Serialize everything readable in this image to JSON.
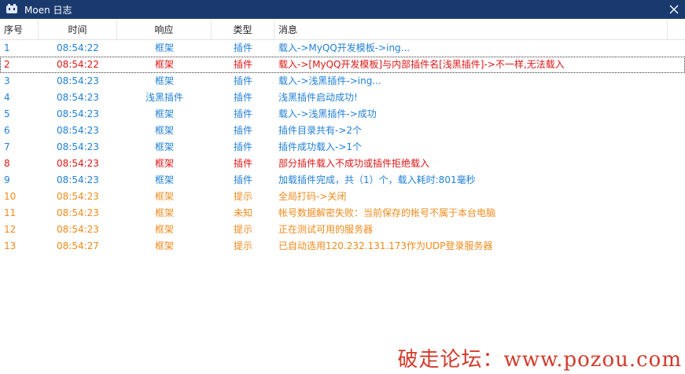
{
  "window": {
    "title": "Moen 日志",
    "app_icon": "moen-app-icon",
    "close_icon": "close-icon"
  },
  "colors": {
    "titlebar": "#1a3a6e",
    "blue": "#1f7fd6",
    "red": "#e01515",
    "orange": "#ef8a1a",
    "watermark": "#d23a2a"
  },
  "columns": {
    "idx": "序号",
    "time": "时间",
    "resp": "响应",
    "type": "类型",
    "msg": "消息"
  },
  "rows": [
    {
      "idx": "1",
      "time": "08:54:22",
      "resp": "框架",
      "type": "插件",
      "msg": "载入->MyQQ开发模板->ing...",
      "color": "#1f7fd6"
    },
    {
      "idx": "2",
      "time": "08:54:22",
      "resp": "框架",
      "type": "插件",
      "msg": "载入->[MyQQ开发模板]与内部插件名[浅黑插件]->不一样,无法载入",
      "color": "#e01515",
      "selected": true
    },
    {
      "idx": "3",
      "time": "08:54:23",
      "resp": "框架",
      "type": "插件",
      "msg": "载入->浅黑插件->ing...",
      "color": "#1f7fd6"
    },
    {
      "idx": "4",
      "time": "08:54:23",
      "resp": "浅黑插件",
      "type": "插件",
      "msg": "浅黑插件启动成功!",
      "color": "#1f7fd6"
    },
    {
      "idx": "5",
      "time": "08:54:23",
      "resp": "框架",
      "type": "插件",
      "msg": "载入->浅黑插件->成功",
      "color": "#1f7fd6"
    },
    {
      "idx": "6",
      "time": "08:54:23",
      "resp": "框架",
      "type": "插件",
      "msg": "插件目录共有->2个",
      "color": "#1f7fd6"
    },
    {
      "idx": "7",
      "time": "08:54:23",
      "resp": "框架",
      "type": "插件",
      "msg": "插件成功载入->1个",
      "color": "#1f7fd6"
    },
    {
      "idx": "8",
      "time": "08:54:23",
      "resp": "框架",
      "type": "插件",
      "msg": "部分插件载入不成功或插件拒绝载入",
      "color": "#e01515"
    },
    {
      "idx": "9",
      "time": "08:54:23",
      "resp": "框架",
      "type": "插件",
      "msg": "加载插件完成，共（1）个，载入耗时:801毫秒",
      "color": "#1f7fd6"
    },
    {
      "idx": "10",
      "time": "08:54:23",
      "resp": "框架",
      "type": "提示",
      "msg": "全局打码->关闭",
      "color": "#ef8a1a"
    },
    {
      "idx": "11",
      "time": "08:54:23",
      "resp": "框架",
      "type": "未知",
      "msg": "帐号数据解密失败：当前保存的帐号不属于本台电脑",
      "color": "#ef8a1a"
    },
    {
      "idx": "12",
      "time": "08:54:23",
      "resp": "框架",
      "type": "提示",
      "msg": "正在测试可用的服务器",
      "color": "#ef8a1a"
    },
    {
      "idx": "13",
      "time": "08:54:27",
      "resp": "框架",
      "type": "提示",
      "msg": "已自动选用120.232.131.173作为UDP登录服务器",
      "color": "#ef8a1a"
    }
  ],
  "watermark": "破走论坛：www.pozou.com"
}
